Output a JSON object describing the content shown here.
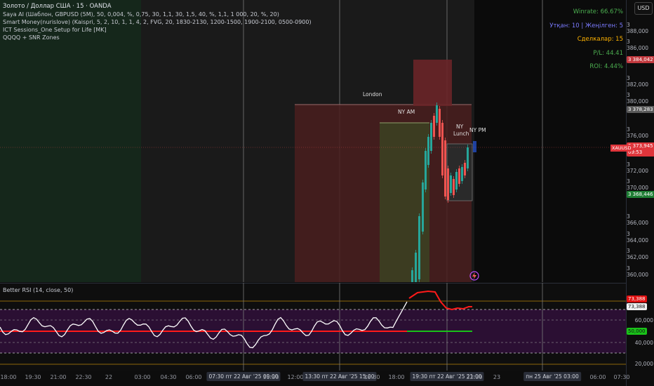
{
  "legend": {
    "title": "Золото / Доллар США · 15 · OANDA",
    "lines": [
      "Saya AI (Шаблон, GBPUSD (5M), 50, 0,004, %, 0,75, 30, 1,1, 30, 1,5, 40, %, 1,1, 1 000, 20, %, 20)",
      "Smart Money(nurislove) (Kaispri, 5, 2, 10, 1, 1, 4, 2, FVG, 20, 1830-2130, 1200-1500, 1900-2100, 0500-0900)",
      "ICT Sessions_One Setup for Life [MK]",
      "QQQQ + SNR Zones"
    ]
  },
  "stats": {
    "winrate": "Winrate: 66.67%",
    "won_lost": "Утқан: 10 | Жеңілген: 5",
    "trades": "Сделкалар: 15",
    "pl": "P/L: 44.41",
    "roi": "ROI: 4.44%"
  },
  "currency_button": "USD",
  "sessions": {
    "london": "London",
    "ny_am": "NY AM",
    "ny_lunch_1": "NY",
    "ny_lunch_2": "Lunch",
    "ny_pm": "NY PM"
  },
  "price_axis": {
    "labels": [
      "3 388,000",
      "3 386,000",
      "3 382,000",
      "3 380,000",
      "3 376,000",
      "3 374,000",
      "3 372,000",
      "3 370,000",
      "3 366,000",
      "3 364,000",
      "3 362,000",
      "3 360,000"
    ],
    "badge_high": "3 384,042",
    "badge_level": "3 378,283",
    "badge_current": "3 373,945",
    "badge_timer": "09:53",
    "badge_low": "3 368,446",
    "symbol": "XAUUSD"
  },
  "rsi": {
    "title": "Better RSI (14, close, 50)",
    "axis_labels": [
      "60,000",
      "40,000",
      "20,000"
    ],
    "badge_red": "73,388",
    "badge_white": "73,388",
    "badge_green": "50,000"
  },
  "time_axis": {
    "labels": [
      "18:00",
      "19:30",
      "21:00",
      "22:30",
      "22",
      "03:00",
      "04:30",
      "06:00",
      "09:30",
      "10:30",
      "12:00",
      "16:30",
      "18:00",
      "23",
      "06:00",
      "07:30"
    ],
    "badges": [
      "07:30 пт 22 Авг '25  09:00",
      "13:30 пт 22 Авг '25  15:00",
      "19:30 пт 22 Авг '25  21:00",
      "пн 25 Авг '25  03:00"
    ],
    "partial": "22:30"
  },
  "colors": {
    "bull": "#26a69a",
    "bear": "#ef5350",
    "rsi_hi": "#ff1a1a",
    "rsi_mid_green": "#19c219",
    "rsi_band": "#2b0f33",
    "london_box": "#4a1d1d",
    "asia_box": "#14261a"
  },
  "icons": [
    "lightning-alert-icon"
  ]
}
